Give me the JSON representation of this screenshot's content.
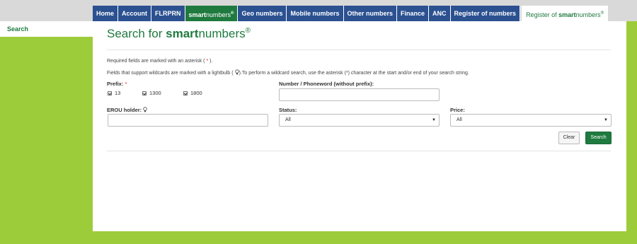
{
  "nav": {
    "tabs": [
      {
        "label": "Home"
      },
      {
        "label": "Account"
      },
      {
        "label": "FLRPRN"
      },
      {
        "label_bold": "smart",
        "label_rest": "numbers",
        "label_sup": "®"
      },
      {
        "label": "Geo numbers"
      },
      {
        "label": "Mobile numbers"
      },
      {
        "label": "Other numbers"
      },
      {
        "label": "Finance"
      },
      {
        "label": "ANC"
      },
      {
        "label": "Register of numbers"
      },
      {
        "label_pre": "Register of ",
        "label_bold": "smart",
        "label_rest": "numbers",
        "label_sup": "®"
      }
    ]
  },
  "sidebar": {
    "items": [
      {
        "label": "Search"
      }
    ]
  },
  "page": {
    "title_pre": "Search for ",
    "title_bold": "smart",
    "title_rest": "numbers",
    "title_sup": "®"
  },
  "notes": {
    "required_pre": "Required fields are marked with an asterisk (",
    "required_mark": " * ",
    "required_post": ").",
    "wildcard_pre": "Fields that support wildcards are marked with a lightbulb (",
    "wildcard_post": ").To perform a wildcard search, use the asterisk (*) character at the start and/or end of your search string."
  },
  "form": {
    "prefix": {
      "label": "Prefix:",
      "required_mark": "*",
      "options": [
        {
          "label": "13",
          "checked": true
        },
        {
          "label": "1300",
          "checked": true
        },
        {
          "label": "1800",
          "checked": true
        }
      ]
    },
    "number": {
      "label": "Number / Phoneword (without prefix):",
      "value": ""
    },
    "erou": {
      "label": "EROU holder:",
      "value": ""
    },
    "status": {
      "label": "Status:",
      "selected": "All"
    },
    "price": {
      "label": "Price:",
      "selected": "All"
    },
    "buttons": {
      "clear": "Clear",
      "search": "Search"
    }
  },
  "icons": {
    "lightbulb": "lightbulb-icon",
    "dropdown": "chevron-down-icon",
    "checkbox": "checkmark-icon"
  },
  "colors": {
    "brand_green": "#1f7a3f",
    "nav_blue": "#2b5191",
    "background_green": "#9dcc3a",
    "required_red": "#dd2222"
  }
}
